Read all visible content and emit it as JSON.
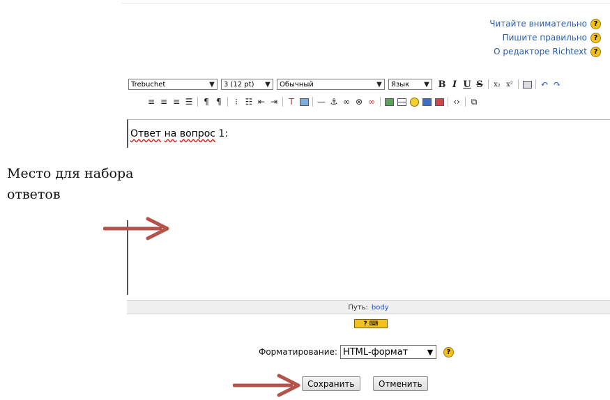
{
  "help_links": [
    {
      "label": "Читайте внимательно",
      "icon": "?"
    },
    {
      "label": "Пишите правильно",
      "icon": "?"
    },
    {
      "label": "О редакторе Richtext",
      "icon": "?"
    }
  ],
  "toolbar": {
    "font_name": "Trebuchet",
    "font_size": "3 (12 pt)",
    "paragraph": "Обычный",
    "language": "Язык",
    "bold": "B",
    "italic": "I",
    "underline": "U",
    "strike": "S",
    "subscript": "x₂",
    "superscript": "x²"
  },
  "editor": {
    "content": "Ответ на вопрос 1:",
    "word_1": "Ответ",
    "word_2": "на",
    "word_3": "вопрос",
    "word_4": "1:"
  },
  "path_bar": {
    "label": "Путь:",
    "value": "body"
  },
  "annotation": {
    "line1": "Место для набора",
    "line2": "ответов"
  },
  "format": {
    "label": "Форматирование:",
    "value": "HTML-формат",
    "help_icon": "?"
  },
  "buttons": {
    "save": "Сохранить",
    "cancel": "Отменить"
  },
  "colors": {
    "arrow": "#b5524c",
    "link": "#2a5ca8",
    "help_icon": "#f2c21b"
  }
}
